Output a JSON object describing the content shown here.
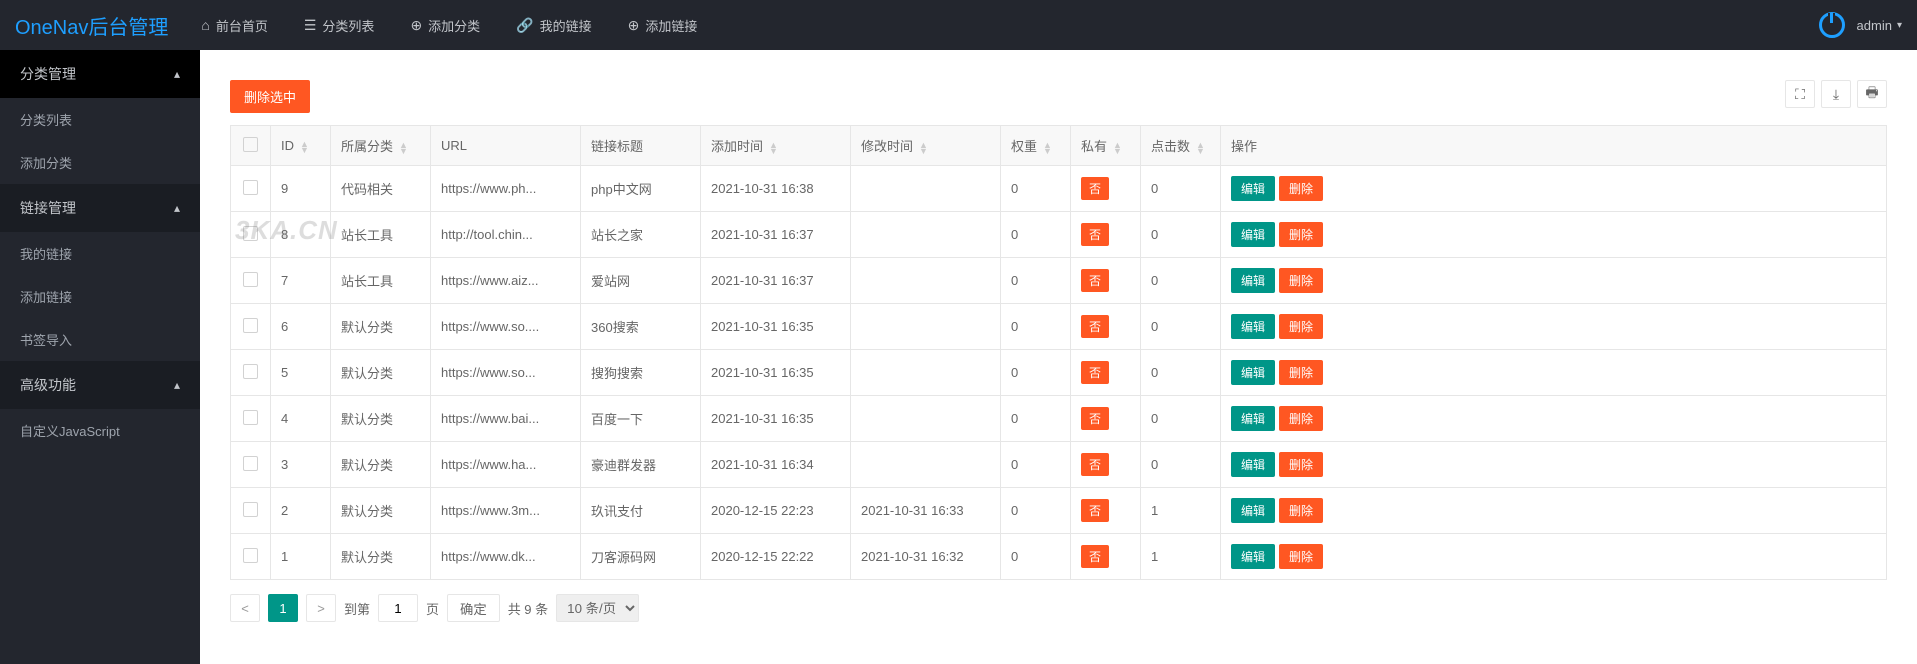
{
  "logo": "OneNav后台管理",
  "topnav": [
    {
      "label": "前台首页",
      "icon": "home"
    },
    {
      "label": "分类列表",
      "icon": "list"
    },
    {
      "label": "添加分类",
      "icon": "add"
    },
    {
      "label": "我的链接",
      "icon": "link"
    },
    {
      "label": "添加链接",
      "icon": "add"
    }
  ],
  "user": {
    "name": "admin"
  },
  "sidebar": {
    "sections": [
      {
        "title": "分类管理",
        "items": [
          "分类列表",
          "添加分类"
        ]
      },
      {
        "title": "链接管理",
        "items": [
          "我的链接",
          "添加链接",
          "书签导入"
        ]
      },
      {
        "title": "高级功能",
        "items": [
          "自定义JavaScript"
        ]
      }
    ]
  },
  "toolbar": {
    "delete_selected": "删除选中"
  },
  "watermark": "3KA.CN",
  "table": {
    "headers": {
      "id": "ID",
      "category": "所属分类",
      "url": "URL",
      "title": "链接标题",
      "add_time": "添加时间",
      "update_time": "修改时间",
      "weight": "权重",
      "private": "私有",
      "clicks": "点击数",
      "actions": "操作"
    },
    "private_no": "否",
    "edit": "编辑",
    "delete": "删除",
    "rows": [
      {
        "id": "9",
        "category": "代码相关",
        "url": "https://www.ph...",
        "title": "php中文网",
        "add_time": "2021-10-31 16:38",
        "update_time": "",
        "weight": "0",
        "clicks": "0"
      },
      {
        "id": "8",
        "category": "站长工具",
        "url": "http://tool.chin...",
        "title": "站长之家",
        "add_time": "2021-10-31 16:37",
        "update_time": "",
        "weight": "0",
        "clicks": "0"
      },
      {
        "id": "7",
        "category": "站长工具",
        "url": "https://www.aiz...",
        "title": "爱站网",
        "add_time": "2021-10-31 16:37",
        "update_time": "",
        "weight": "0",
        "clicks": "0"
      },
      {
        "id": "6",
        "category": "默认分类",
        "url": "https://www.so....",
        "title": "360搜索",
        "add_time": "2021-10-31 16:35",
        "update_time": "",
        "weight": "0",
        "clicks": "0"
      },
      {
        "id": "5",
        "category": "默认分类",
        "url": "https://www.so...",
        "title": "搜狗搜索",
        "add_time": "2021-10-31 16:35",
        "update_time": "",
        "weight": "0",
        "clicks": "0"
      },
      {
        "id": "4",
        "category": "默认分类",
        "url": "https://www.bai...",
        "title": "百度一下",
        "add_time": "2021-10-31 16:35",
        "update_time": "",
        "weight": "0",
        "clicks": "0"
      },
      {
        "id": "3",
        "category": "默认分类",
        "url": "https://www.ha...",
        "title": "豪迪群发器",
        "add_time": "2021-10-31 16:34",
        "update_time": "",
        "weight": "0",
        "clicks": "0"
      },
      {
        "id": "2",
        "category": "默认分类",
        "url": "https://www.3m...",
        "title": "玖讯支付",
        "add_time": "2020-12-15 22:23",
        "update_time": "2021-10-31 16:33",
        "weight": "0",
        "clicks": "1"
      },
      {
        "id": "1",
        "category": "默认分类",
        "url": "https://www.dk...",
        "title": "刀客源码网",
        "add_time": "2020-12-15 22:22",
        "update_time": "2021-10-31 16:32",
        "weight": "0",
        "clicks": "1"
      }
    ]
  },
  "pagination": {
    "current": "1",
    "goto_label": "到第",
    "page_label": "页",
    "confirm": "确定",
    "total": "共 9 条",
    "per_page": "10 条/页",
    "page_input": "1"
  }
}
